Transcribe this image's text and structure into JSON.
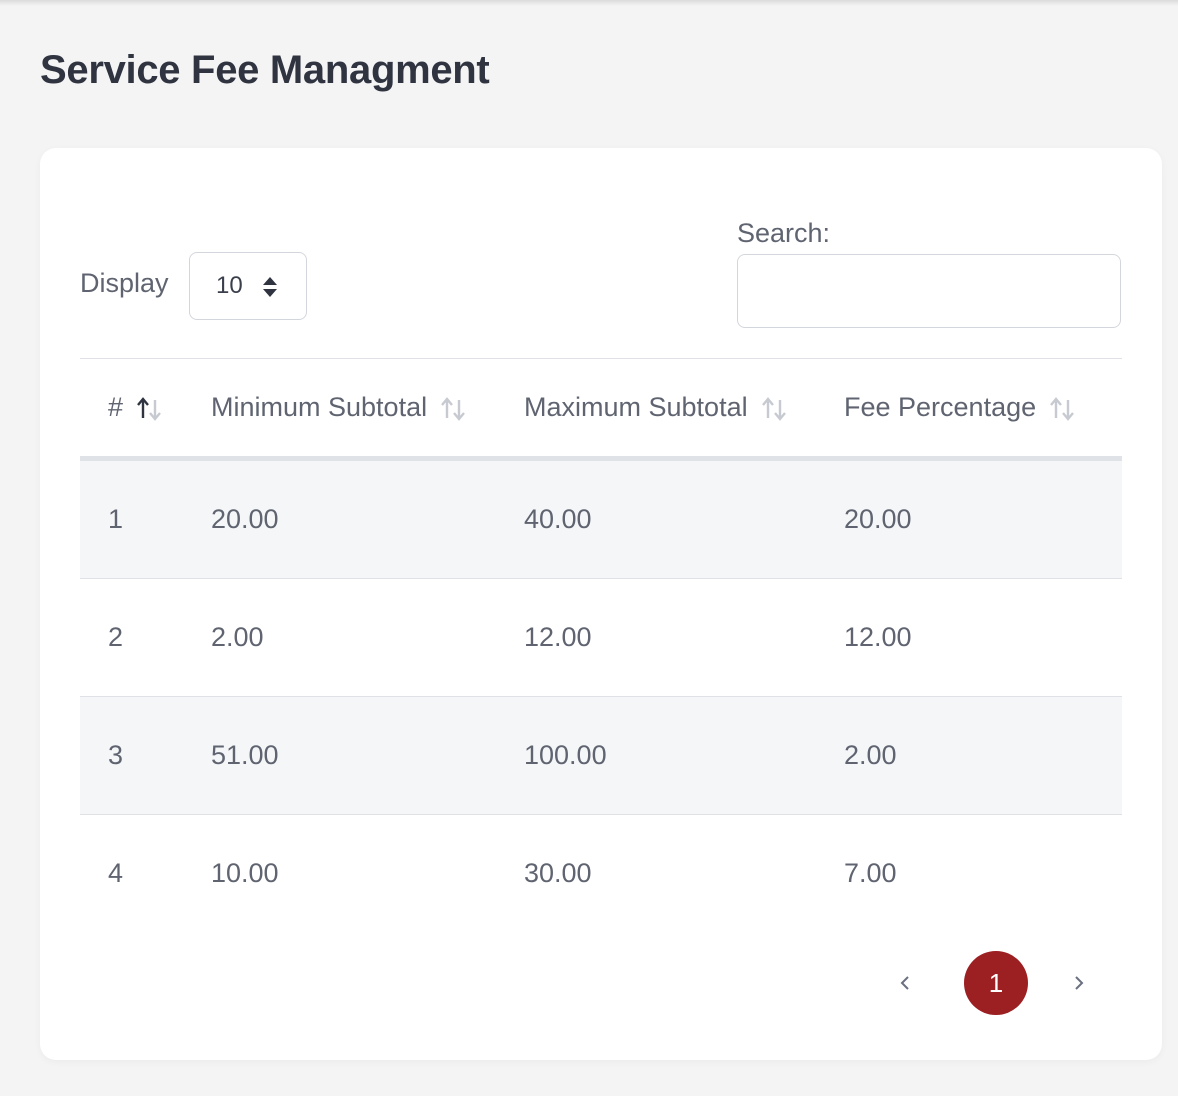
{
  "page": {
    "title": "Service Fee Managment"
  },
  "controls": {
    "display_label": "Display",
    "display_value": "10",
    "search_label": "Search:",
    "search_value": "",
    "search_placeholder": ""
  },
  "table": {
    "columns": [
      "#",
      "Minimum Subtotal",
      "Maximum Subtotal",
      "Fee Percentage"
    ],
    "rows": [
      [
        "1",
        "20.00",
        "40.00",
        "20.00"
      ],
      [
        "2",
        "2.00",
        "12.00",
        "12.00"
      ],
      [
        "3",
        "51.00",
        "100.00",
        "2.00"
      ],
      [
        "4",
        "10.00",
        "30.00",
        "7.00"
      ]
    ]
  },
  "pagination": {
    "current_page": "1"
  },
  "colors": {
    "accent": "#9c1f22",
    "background": "#f4f4f5",
    "row_stripe": "#f5f6f8"
  },
  "icons": {
    "sort": "sort-arrows-icon",
    "select": "updown-icon",
    "prev": "chevron-left-icon",
    "next": "chevron-right-icon"
  }
}
